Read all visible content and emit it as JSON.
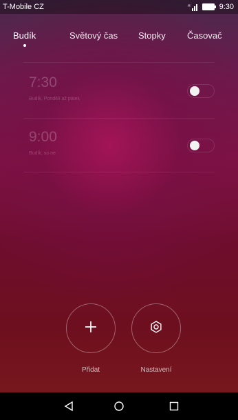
{
  "status_bar": {
    "carrier": "T-Mobile CZ",
    "time": "9:30"
  },
  "tabs": [
    {
      "label": "Budík",
      "active": true
    },
    {
      "label": "Světový čas",
      "active": false
    },
    {
      "label": "Stopky",
      "active": false
    },
    {
      "label": "Časovač",
      "active": false
    }
  ],
  "alarms": [
    {
      "time": "7:30",
      "description": "Budík, Pondělí až pátek",
      "enabled": false
    },
    {
      "time": "9:00",
      "description": "Budík, so ne",
      "enabled": false
    }
  ],
  "actions": {
    "add_label": "Přidat",
    "settings_label": "Nastavení"
  },
  "nav_bar": {
    "icons": [
      "back-icon",
      "home-icon",
      "recents-icon"
    ]
  }
}
